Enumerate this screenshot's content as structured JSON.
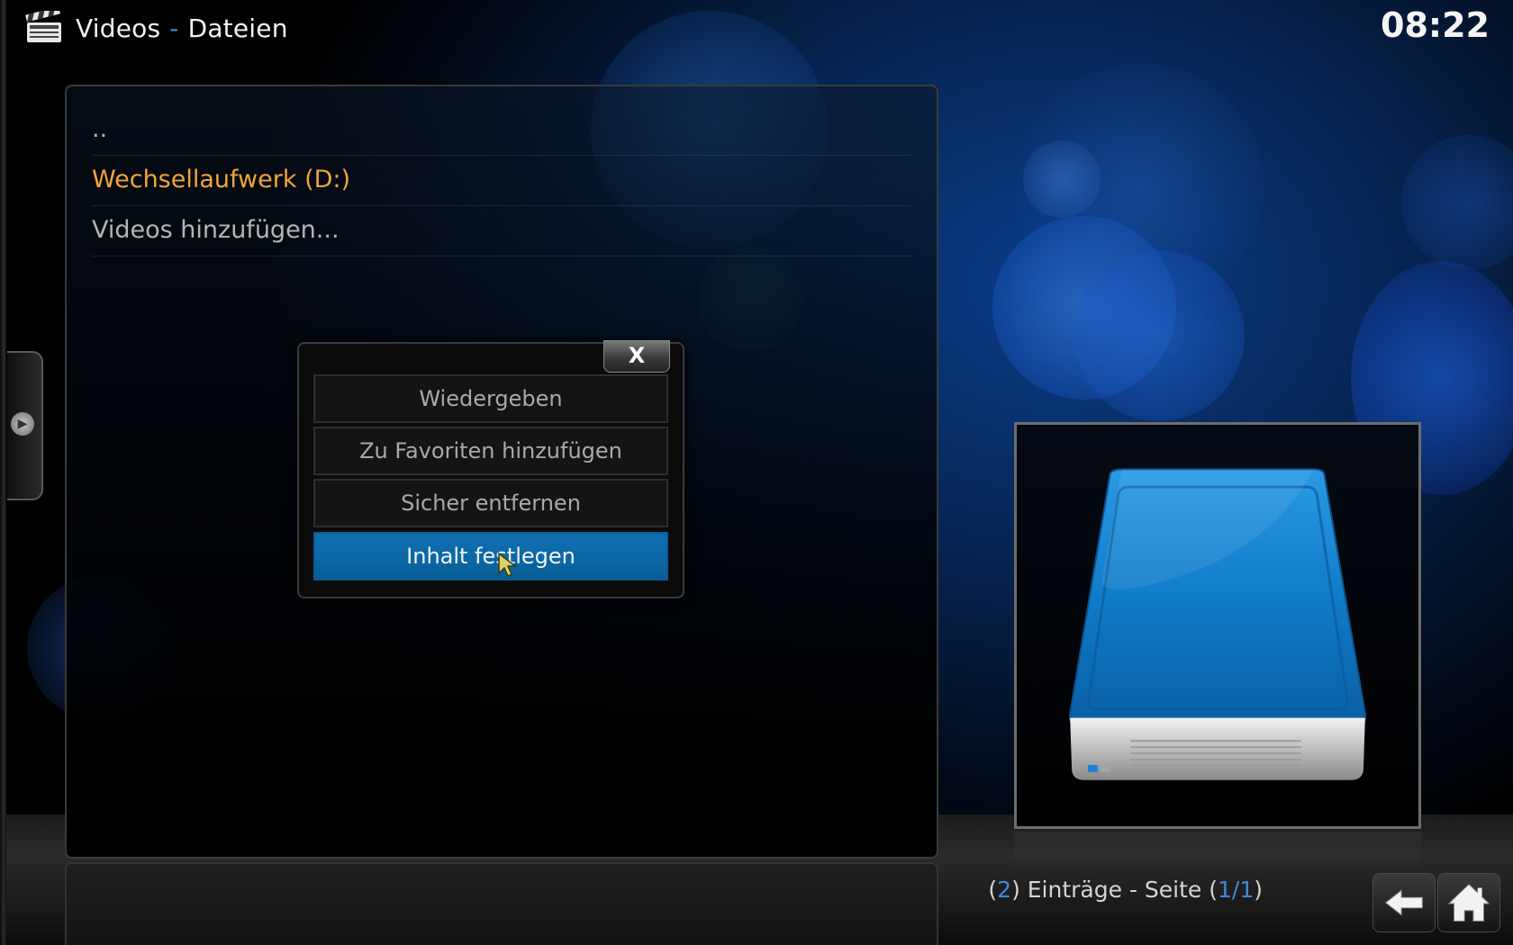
{
  "header": {
    "section": "Videos",
    "separator": "-",
    "subsection": "Dateien",
    "clock": "08:22"
  },
  "file_list": {
    "items": [
      {
        "label": "..",
        "highlighted": false
      },
      {
        "label": "Wechsellaufwerk (D:)",
        "highlighted": true
      },
      {
        "label": "Videos hinzufügen...",
        "highlighted": false
      }
    ]
  },
  "context_menu": {
    "close_label": "X",
    "items": [
      {
        "label": "Wiedergeben",
        "selected": false
      },
      {
        "label": "Zu Favoriten hinzufügen",
        "selected": false
      },
      {
        "label": "Sicher entfernen",
        "selected": false
      },
      {
        "label": "Inhalt festlegen",
        "selected": true
      }
    ]
  },
  "thumbnail": {
    "icon": "removable-drive-icon"
  },
  "footer": {
    "count_open": "(",
    "count": "2",
    "count_text": ") Einträge - Seite (",
    "page": "1/1",
    "page_close": ")",
    "back_icon": "back-arrow-icon",
    "home_icon": "home-icon"
  },
  "colors": {
    "accent": "#3d8ad9",
    "highlight_text": "#f1a33a",
    "selected_item": "#0b69a9"
  }
}
